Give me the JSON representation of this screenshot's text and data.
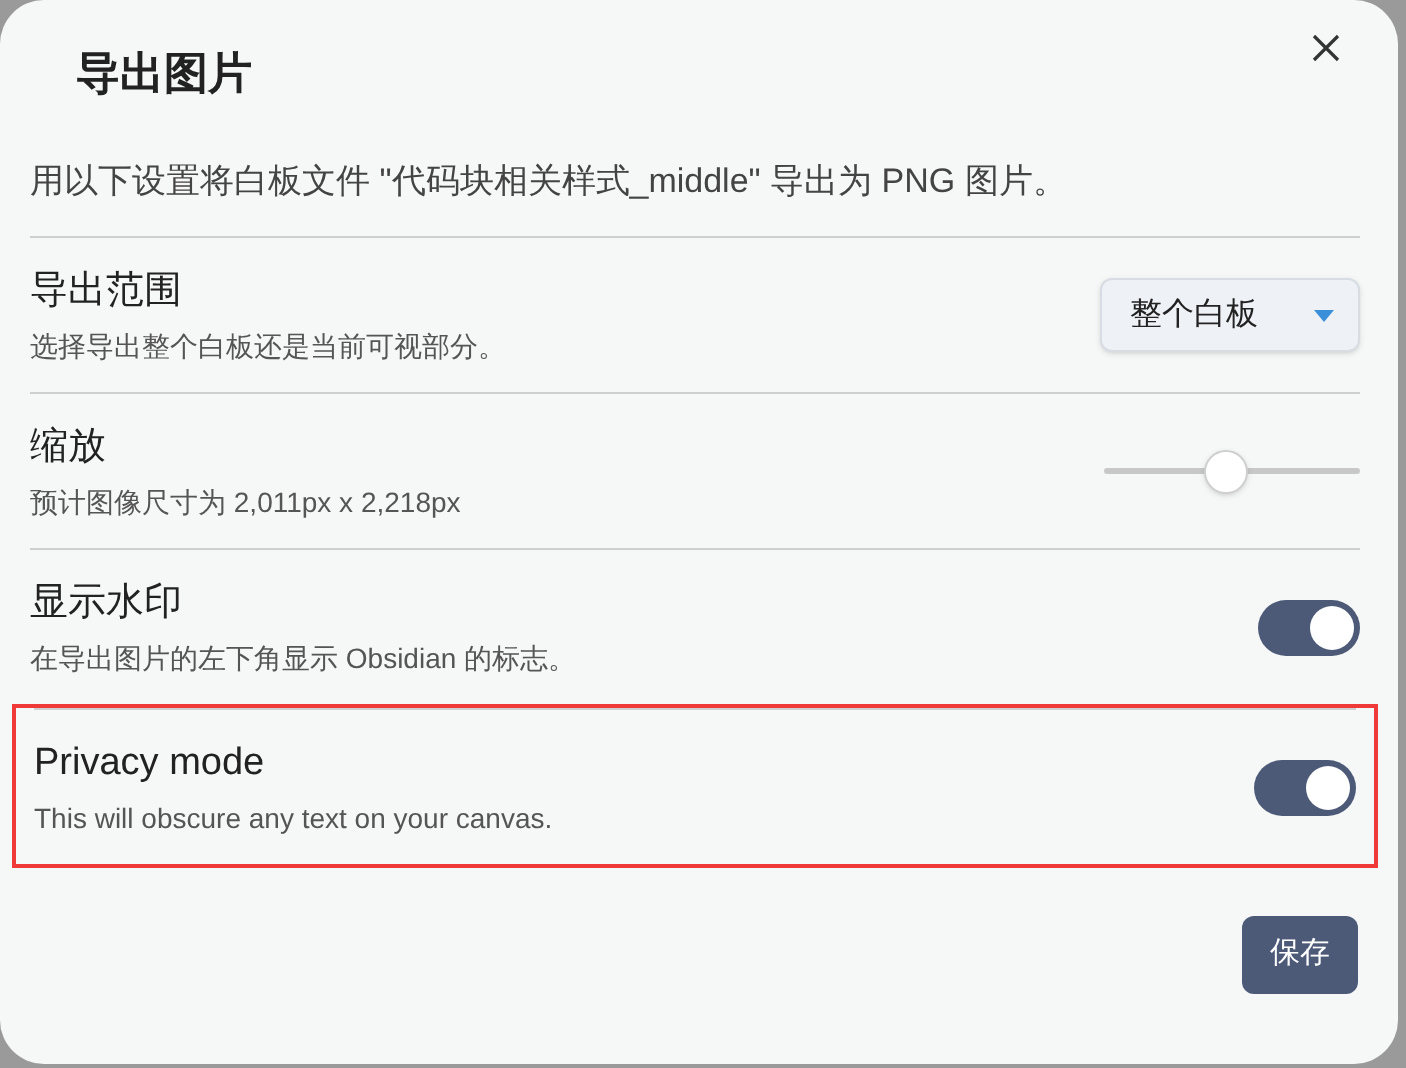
{
  "dialog": {
    "title": "导出图片",
    "description": "用以下设置将白板文件 \"代码块相关样式_middle\" 导出为 PNG 图片。"
  },
  "settings": [
    {
      "kind": "dropdown",
      "name": "导出范围",
      "description": "选择导出整个白板还是当前可视部分。",
      "value": "整个白板",
      "highlighted": false
    },
    {
      "kind": "slider",
      "name": "缩放",
      "description": "预计图像尺寸为 2,011px x 2,218px",
      "level": 0.48,
      "highlighted": false
    },
    {
      "kind": "toggle",
      "name": "显示水印",
      "description": "在导出图片的左下角显示 Obsidian 的标志。",
      "on": true,
      "highlighted": false
    },
    {
      "kind": "toggle",
      "name": "Privacy mode",
      "description": "This will obscure any text on your canvas.",
      "on": true,
      "highlighted": true
    }
  ],
  "buttons": [
    {
      "label": "保存"
    }
  ]
}
